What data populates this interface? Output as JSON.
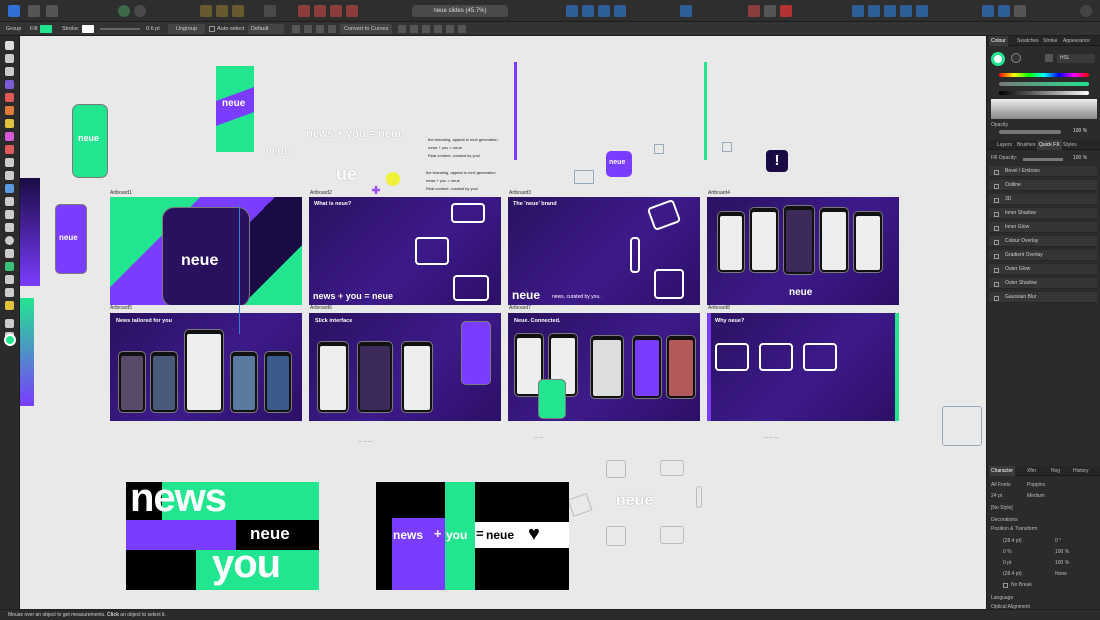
{
  "document": {
    "title": "neue slides (45.7%)"
  },
  "context_bar": {
    "mode": "Group",
    "fill_label": "Fill:",
    "stroke_label": "Stroke:",
    "stroke_width": "0.6 pt",
    "ungroup": "Ungroup",
    "auto_select": "Auto-select",
    "auto_select_value": "Default",
    "convert_to_curves": "Convert to Curves"
  },
  "colors": {
    "accent_green": "#22e58f",
    "accent_purple": "#7a3cff",
    "deep_purple": "#2c0f66",
    "ui_dark": "#2b2b2b"
  },
  "canvas": {
    "logo": "neue",
    "headline": "news + you = neue",
    "notes": [
      "the branding, appeal to next generation",
      "news + you = neue",
      "Real content, curated by you!"
    ],
    "artboards": [
      {
        "label": "Artboard1",
        "title": ""
      },
      {
        "label": "Artboard2",
        "title": "What is neue?",
        "tagline": "news + you = neue"
      },
      {
        "label": "Artboard3",
        "title": "The 'neue' brand",
        "tagline": "neue",
        "tagline_sub": "news, curated by you."
      },
      {
        "label": "Artboard4",
        "title": "",
        "tagline": "neue"
      },
      {
        "label": "Artboard5",
        "title": "News tailored for you"
      },
      {
        "label": "Artboard6",
        "title": "Slick interface"
      },
      {
        "label": "Artboard7",
        "title": "Neue. Connected."
      },
      {
        "label": "Artboard8",
        "title": "Why neue?"
      }
    ],
    "poster1": {
      "line1": "news",
      "line2": "neue",
      "line3": "you"
    },
    "poster2": {
      "part1": "news",
      "part2": "+",
      "part3": "you",
      "part4": "=",
      "part5": "neue"
    }
  },
  "right_panel": {
    "top_tabs": [
      "Colour",
      "Swatches",
      "Stroke",
      "Appearance"
    ],
    "color_model": "HSL",
    "opacity_label": "Opacity",
    "opacity_value": "100 %",
    "mid_tabs": [
      "Layers",
      "Brushes",
      "Quick FX",
      "Styles"
    ],
    "fill_opacity": "Fill Opacity:",
    "fill_opacity_value": "100 %",
    "fx_items": [
      "Bevel / Emboss",
      "Outline",
      "3D",
      "Inner Shadow",
      "Inner Glow",
      "Colour Overlay",
      "Gradient Overlay",
      "Outer Glow",
      "Outer Shadow",
      "Gaussian Blur"
    ],
    "bottom_tabs": [
      "Character",
      "Xfm",
      "Nvg",
      "History"
    ],
    "font_collection": "All Fonts",
    "font_family": "Poppins",
    "font_size": "24 pt",
    "font_weight": "Medium",
    "style": "[No Style]",
    "sections": [
      "Decorations",
      "Position & Transform"
    ],
    "transform_values": [
      "0 %",
      "100 %",
      "0 pt",
      "100 %",
      "0 pt",
      "None",
      "(28.4 pt)",
      "0 °"
    ],
    "no_break": "No Break",
    "footer_sections": [
      "Language",
      "Optical Alignment"
    ]
  },
  "status": {
    "text_prefix": "Mouse over an object to get measurements. ",
    "click1": "Click",
    "text_mid": " an object to select it."
  }
}
